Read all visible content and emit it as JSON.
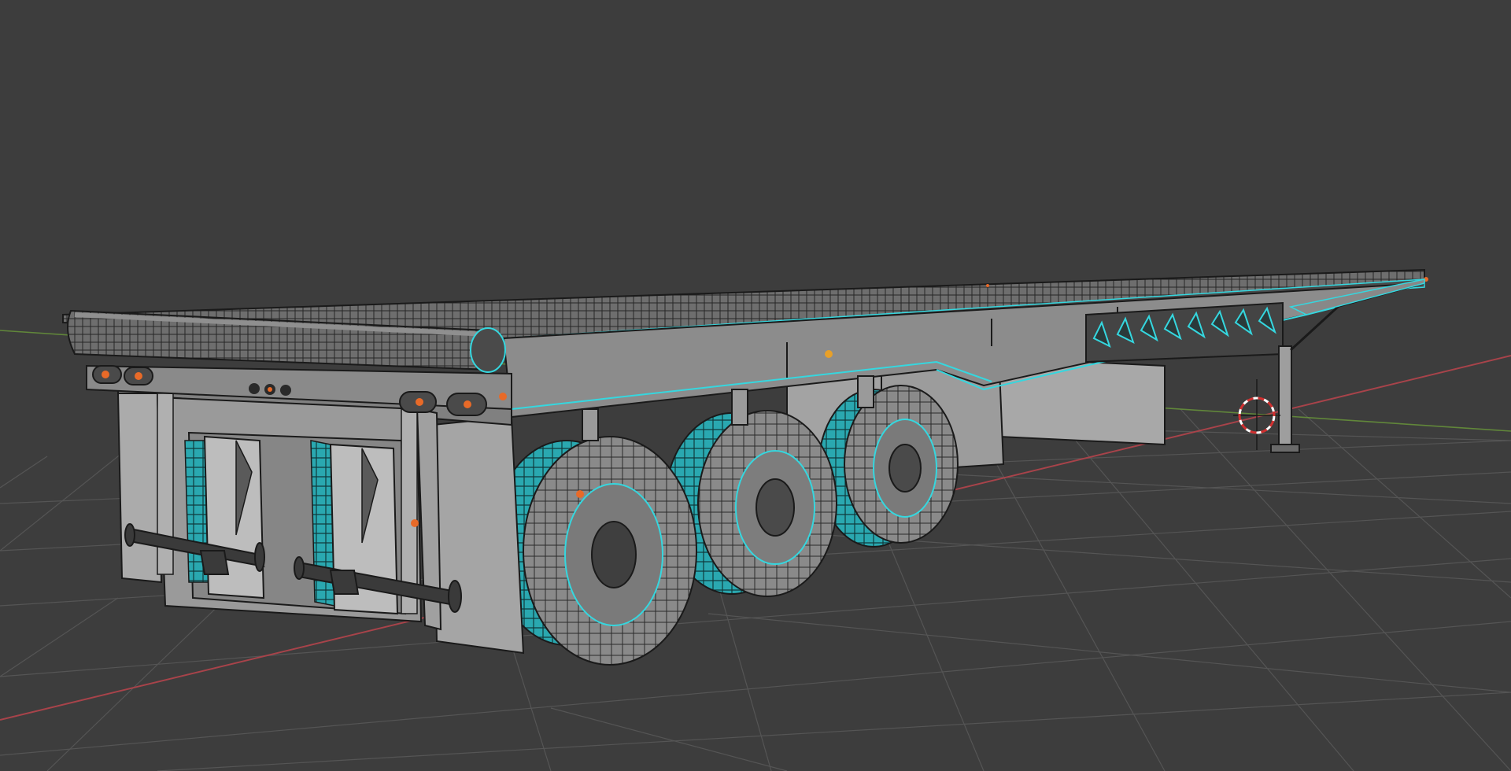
{
  "viewport": {
    "mode": "edit-mode-wireframe-overlay",
    "background_color": "#3d3d3d",
    "grid_color": "#555555",
    "x_axis_color": "#a8434a",
    "y_axis_color": "#6a9a3a",
    "selection_color": "#35d7df",
    "vertex_color": "#e86a28",
    "object": "flatbed-semi-trailer",
    "cursor": "3d-cursor-icon"
  }
}
